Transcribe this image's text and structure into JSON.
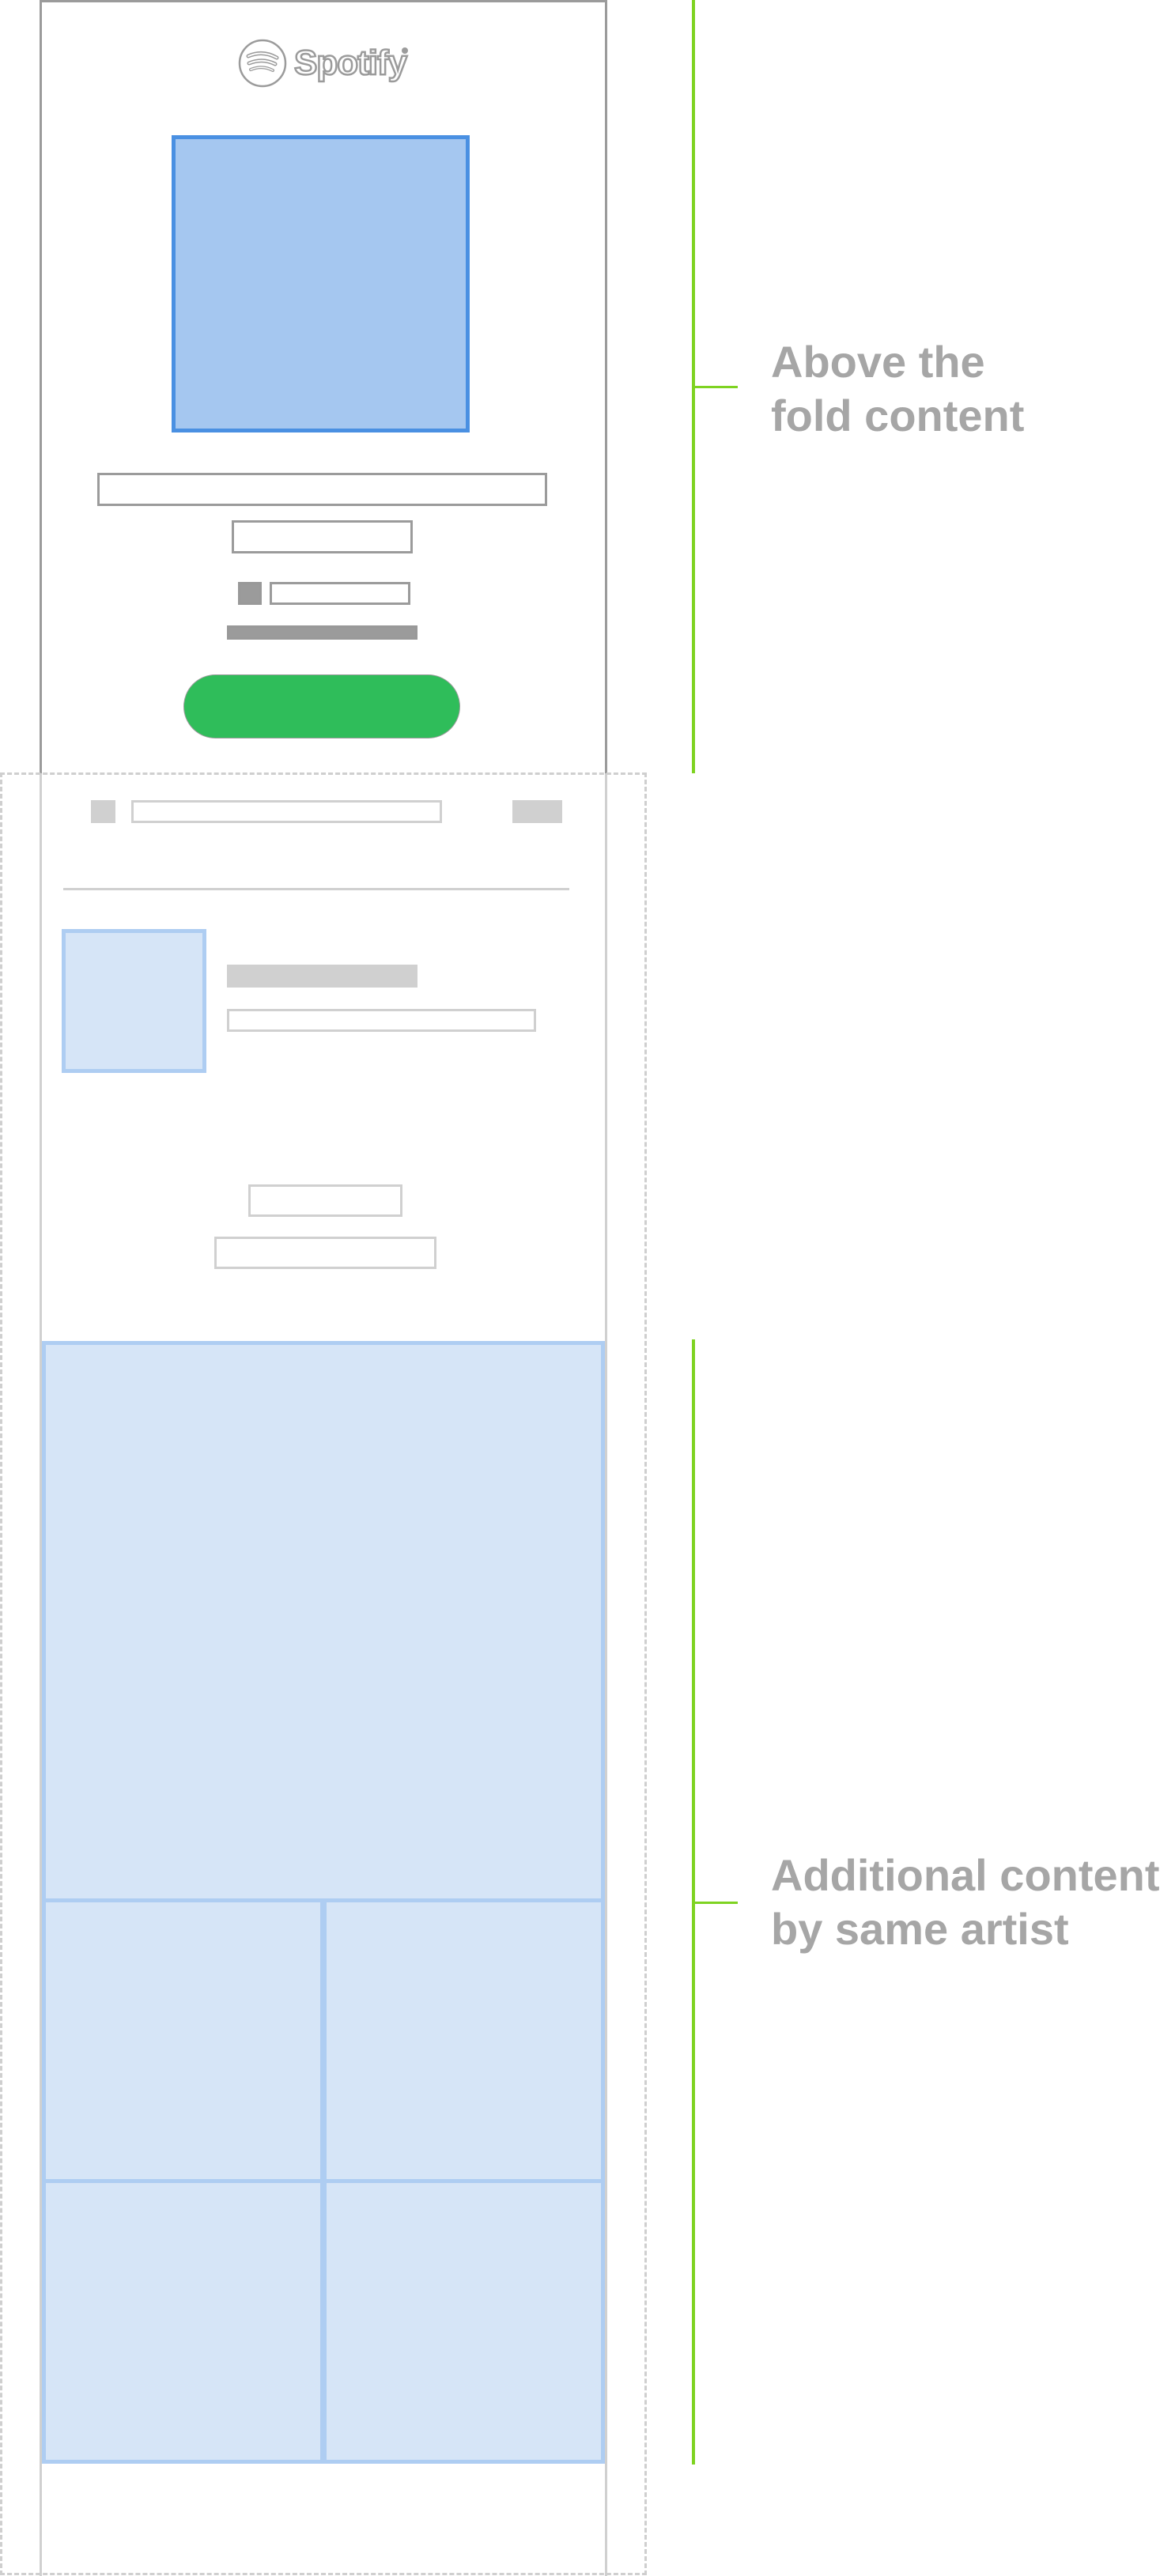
{
  "logo": {
    "text": "Spotify",
    "icon": "spotify-icon"
  },
  "colors": {
    "frame_above_fold": "#9b9b9b",
    "frame_below_fold": "#d0d0d0",
    "album_art_fill": "#a5c7f0",
    "album_art_border": "#4a90e2",
    "placeholder_blue_fill": "#d6e5f7",
    "placeholder_blue_border": "#aecdf2",
    "play_button": "#2fbd5a",
    "bracket": "#7ed321",
    "annotation_text": "#a6a6a6"
  },
  "annotations": [
    {
      "lines": [
        "Above the",
        "fold content"
      ]
    },
    {
      "lines": [
        "Additional content",
        "by same artist"
      ]
    }
  ]
}
